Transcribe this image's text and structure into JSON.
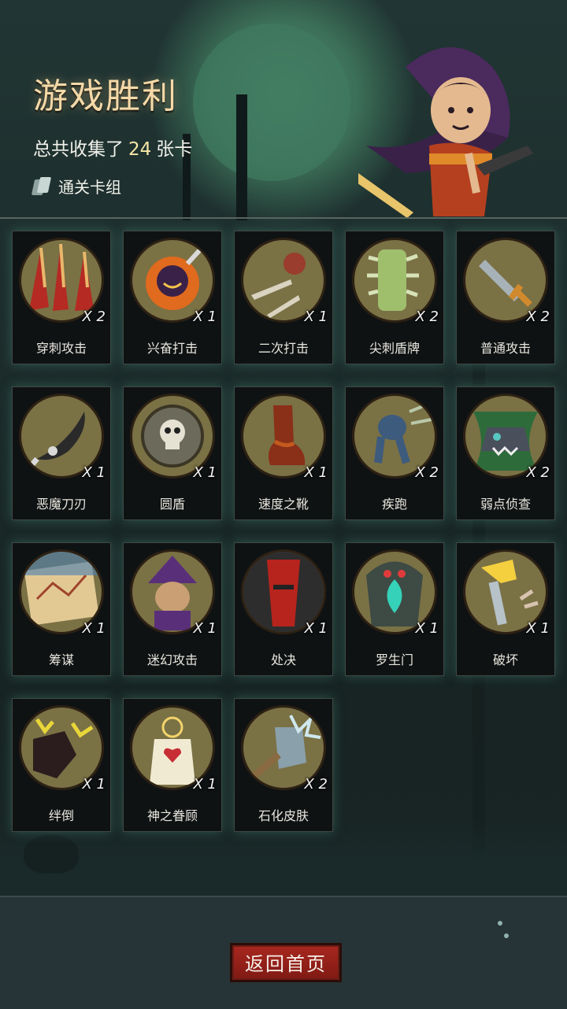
{
  "header": {
    "title": "游戏胜利",
    "collected_prefix": "总共收集了",
    "collected_count": "24",
    "collected_suffix": "张卡",
    "deck_label": "通关卡组"
  },
  "cards": [
    {
      "name": "穿刺攻击",
      "count": "X 2",
      "icon": "spikes-icon",
      "colors": [
        "#b52a22",
        "#e9b86b"
      ]
    },
    {
      "name": "兴奋打击",
      "count": "X 1",
      "icon": "fiery-hero-icon",
      "colors": [
        "#e06a1d",
        "#f3c34a"
      ]
    },
    {
      "name": "二次打击",
      "count": "X 1",
      "icon": "daggers-icon",
      "colors": [
        "#9a3c2e",
        "#d9d3c0"
      ]
    },
    {
      "name": "尖刺盾牌",
      "count": "X 2",
      "icon": "spiked-shield-icon",
      "colors": [
        "#9fbf6d",
        "#d7e3b7"
      ]
    },
    {
      "name": "普通攻击",
      "count": "X 2",
      "icon": "sword-icon",
      "colors": [
        "#a7b2b8",
        "#d08a2d"
      ]
    },
    {
      "name": "恶魔刀刃",
      "count": "X 1",
      "icon": "demon-blade-icon",
      "colors": [
        "#2a2a2a",
        "#d9d9d9"
      ]
    },
    {
      "name": "圆盾",
      "count": "X 1",
      "icon": "round-shield-icon",
      "colors": [
        "#6c6a5a",
        "#e6e2d3"
      ]
    },
    {
      "name": "速度之靴",
      "count": "X 1",
      "icon": "boot-icon",
      "colors": [
        "#8a2f18",
        "#c35a1e"
      ]
    },
    {
      "name": "疾跑",
      "count": "X 2",
      "icon": "running-creature-icon",
      "colors": [
        "#3d5b7d",
        "#b9c7a8"
      ]
    },
    {
      "name": "弱点侦查",
      "count": "X 2",
      "icon": "wolf-icon",
      "colors": [
        "#2e6b3a",
        "#4a4f5c"
      ]
    },
    {
      "name": "筹谋",
      "count": "X 1",
      "icon": "map-icon",
      "colors": [
        "#4a7fb0",
        "#e2c994"
      ]
    },
    {
      "name": "迷幻攻击",
      "count": "X 1",
      "icon": "witch-icon",
      "colors": [
        "#5a2f7a",
        "#c99f73"
      ]
    },
    {
      "name": "处决",
      "count": "X 1",
      "icon": "executioner-icon",
      "colors": [
        "#b7241d",
        "#2d2d2d"
      ]
    },
    {
      "name": "罗生门",
      "count": "X 1",
      "icon": "demon-gate-icon",
      "colors": [
        "#3e4a44",
        "#35d1b8"
      ]
    },
    {
      "name": "破坏",
      "count": "X 1",
      "icon": "hammer-icon",
      "colors": [
        "#f4d03f",
        "#b6c2c8"
      ]
    },
    {
      "name": "绊倒",
      "count": "X 1",
      "icon": "tripping-boot-icon",
      "colors": [
        "#2b1d1d",
        "#e8d63a"
      ]
    },
    {
      "name": "神之眷顾",
      "count": "X 1",
      "icon": "angel-icon",
      "colors": [
        "#f1ead2",
        "#c72e35"
      ]
    },
    {
      "name": "石化皮肤",
      "count": "X 2",
      "icon": "stone-fist-icon",
      "colors": [
        "#8aa0ab",
        "#cfe8ef"
      ]
    }
  ],
  "footer": {
    "home_label": "返回首页"
  }
}
